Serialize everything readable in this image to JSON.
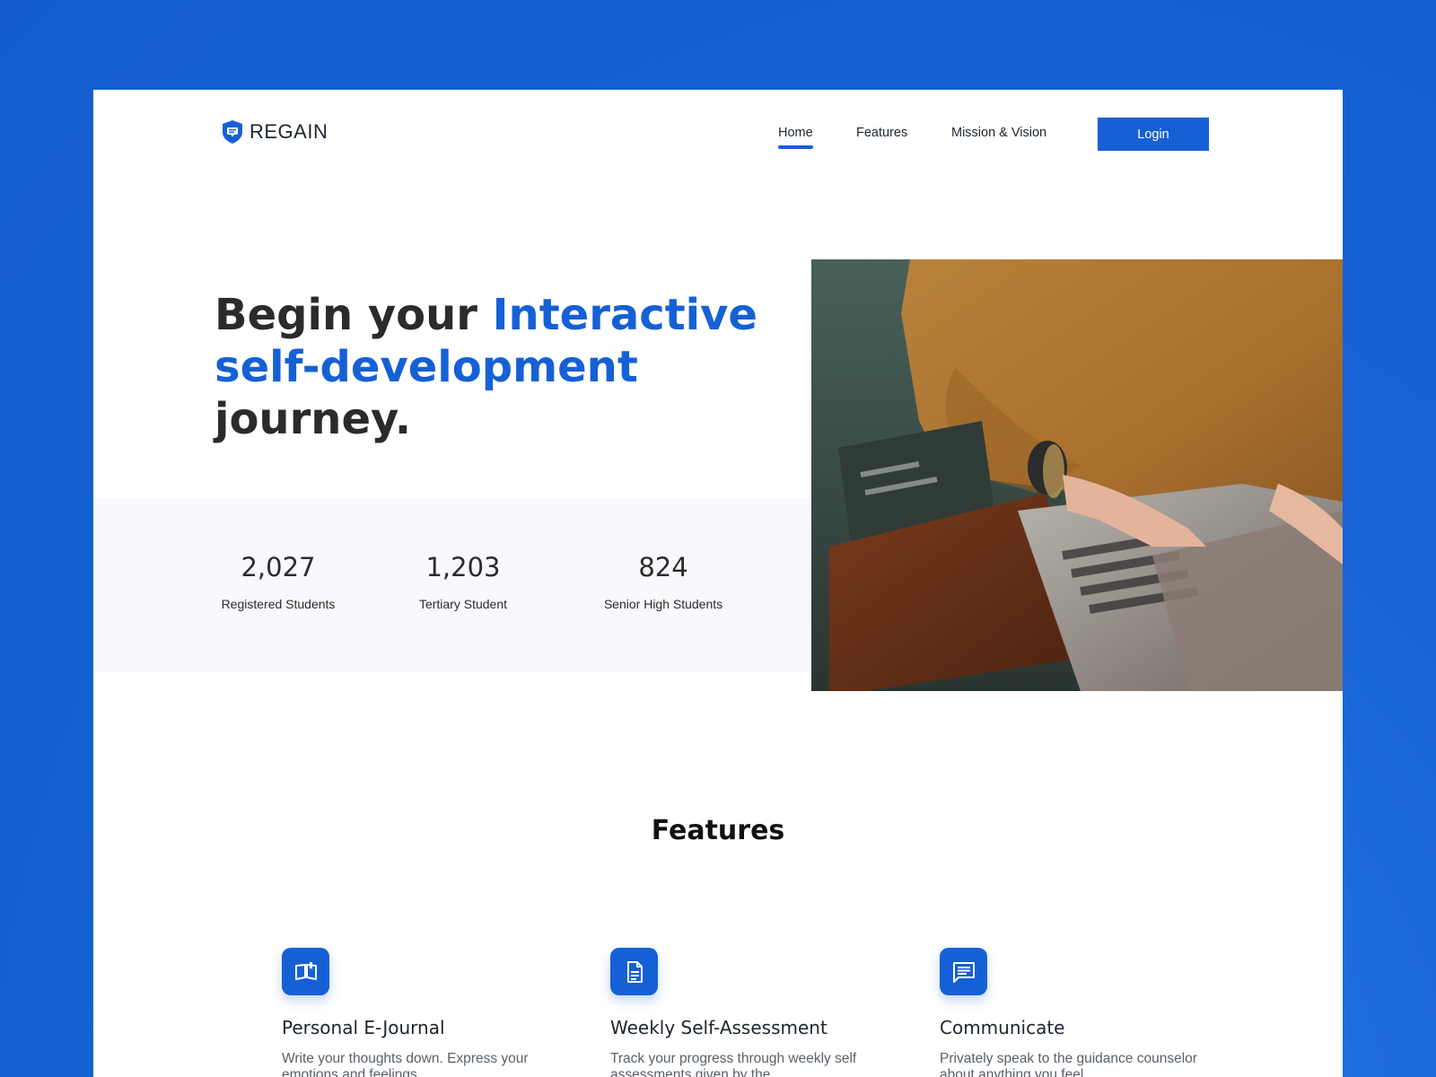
{
  "brand": {
    "name": "REGAIN",
    "logo_icon": "shield-chat-icon",
    "accent": "#1660d6"
  },
  "nav": {
    "items": [
      {
        "label": "Home",
        "active": true
      },
      {
        "label": "Features",
        "active": false
      },
      {
        "label": "Mission & Vision",
        "active": false
      }
    ],
    "login_label": "Login"
  },
  "hero": {
    "title_part1": "Begin your ",
    "title_highlight": "Interactive self-development",
    "title_part2": " journey.",
    "image_alt_icon": "photo-person-laptop"
  },
  "stats": [
    {
      "value": "2,027",
      "label": "Registered Students"
    },
    {
      "value": "1,203",
      "label": "Tertiary Student"
    },
    {
      "value": "824",
      "label": "Senior High Students"
    }
  ],
  "features": {
    "heading": "Features",
    "items": [
      {
        "icon": "book-open-icon",
        "title": "Personal E-Journal",
        "desc": "Write your thoughts down. Express your emotions and feelings."
      },
      {
        "icon": "document-icon",
        "title": "Weekly Self-Assessment",
        "desc": "Track your progress through weekly self assessments given by the"
      },
      {
        "icon": "chat-icon",
        "title": "Communicate",
        "desc": "Privately speak to the guidance counselor about anything you feel"
      }
    ]
  }
}
